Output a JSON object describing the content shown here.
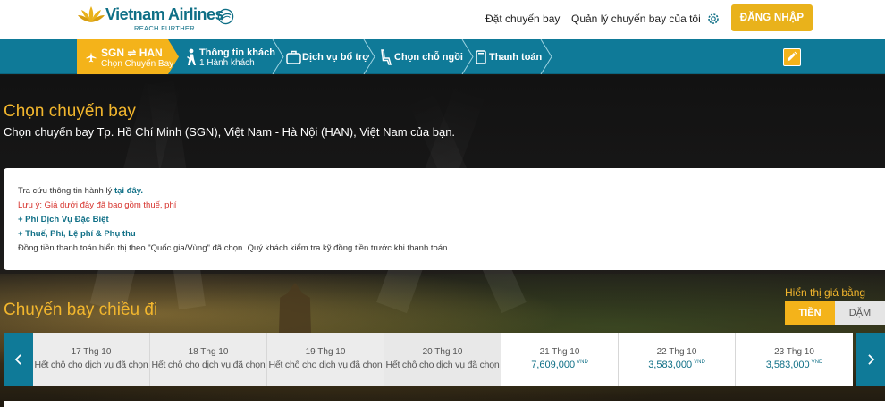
{
  "header": {
    "logo_name": "Vietnam Airlines",
    "logo_tagline": "REACH FURTHER",
    "nav_book": "Đặt chuyến bay",
    "nav_manage": "Quản lý chuyến bay của tôi",
    "login_label": "ĐĂNG NHẬP"
  },
  "steps": [
    {
      "title": "SGN ⇌ HAN",
      "sub": "Chọn Chuyến Bay",
      "icon": "airplane-icon",
      "active": true
    },
    {
      "title": "Thông tin khách",
      "sub": "1 Hành khách",
      "icon": "passenger-icon"
    },
    {
      "title": "Dịch vụ bổ trợ",
      "sub": "",
      "icon": "luggage-icon"
    },
    {
      "title": "Chọn chỗ ngồi",
      "sub": "",
      "icon": "seat-icon"
    },
    {
      "title": "Thanh toán",
      "sub": "",
      "icon": "payment-icon"
    }
  ],
  "hero": {
    "title": "Chọn chuyến bay",
    "subtitle": "Chọn chuyến bay Tp. Hồ Chí Minh (SGN), Việt Nam - Hà Nội (HAN), Việt Nam của bạn."
  },
  "info": {
    "baggage_text": "Tra cứu thông tin hành lý ",
    "baggage_link": "tại đây.",
    "note": "Lưu ý: Giá dưới đây đã bao gồm thuế, phí",
    "special_fee": "+ Phí Dịch Vụ Đặc Biệt",
    "taxes": "+ Thuế, Phí, Lệ phí & Phụ thu",
    "currency_note": "Đồng tiền thanh toán hiển thị theo \"Quốc gia/Vùng\" đã chọn. Quý khách kiểm tra kỹ đồng tiền trước khi thanh toán."
  },
  "outbound": {
    "title": "Chuyến bay chiều đi",
    "display_label": "Hiển thị giá bằng",
    "toggle_money": "TIỀN",
    "toggle_miles": "DẶM"
  },
  "dates": [
    {
      "label": "17 Thg 10",
      "note": "Hết chỗ cho dịch vụ đã chọn",
      "available": false
    },
    {
      "label": "18 Thg 10",
      "note": "Hết chỗ cho dịch vụ đã chọn",
      "available": false
    },
    {
      "label": "19 Thg 10",
      "note": "Hết chỗ cho dịch vụ đã chọn",
      "available": false
    },
    {
      "label": "20 Thg 10",
      "note": "Hết chỗ cho dịch vụ đã chọn",
      "available": false
    },
    {
      "label": "21 Thg 10",
      "price": "7,609,000",
      "currency": "VND",
      "available": true
    },
    {
      "label": "22 Thg 10",
      "price": "3,583,000",
      "currency": "VND",
      "available": true
    },
    {
      "label": "23 Thg 10",
      "price": "3,583,000",
      "currency": "VND",
      "available": true
    }
  ],
  "colors": {
    "brand_teal": "#0f7a98",
    "accent_gold": "#f4b31a",
    "alert_red": "#d6322c"
  }
}
